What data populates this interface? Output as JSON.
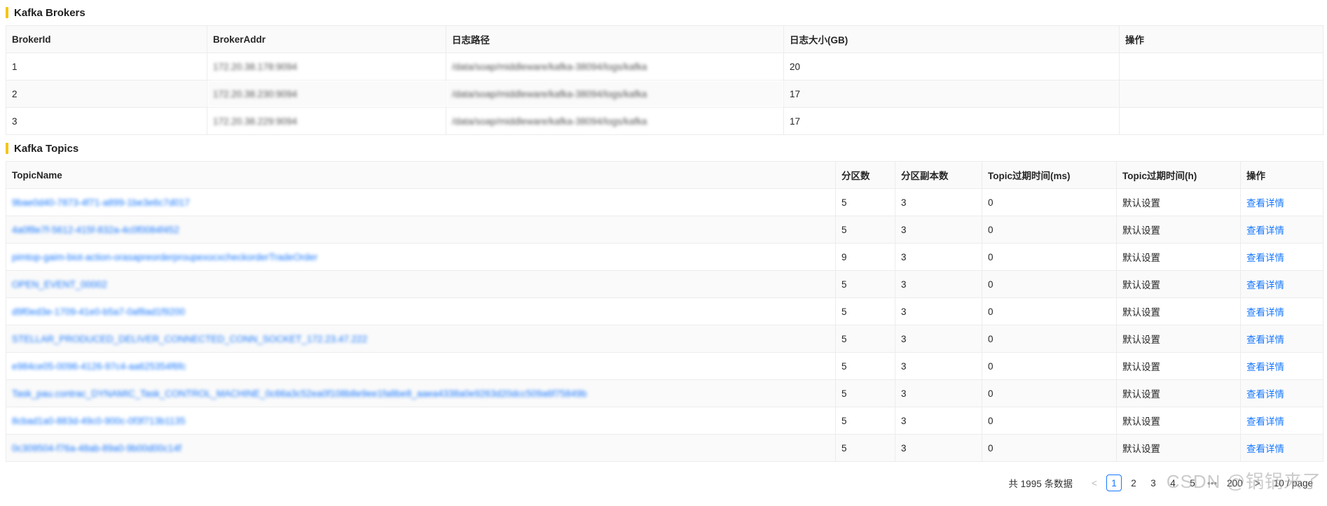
{
  "brokers": {
    "title": "Kafka Brokers",
    "columns": [
      "BrokerId",
      "BrokerAddr",
      "日志路径",
      "日志大小(GB)",
      "操作"
    ],
    "rows": [
      {
        "id": "1",
        "addr": "172.20.38.178:9094",
        "path": "/data/soap/middleware/kafka-38094/logs/kafka",
        "size": "20",
        "action": ""
      },
      {
        "id": "2",
        "addr": "172.20.38.230:9094",
        "path": "/data/soap/middleware/kafka-38094/logs/kafka",
        "size": "17",
        "action": ""
      },
      {
        "id": "3",
        "addr": "172.20.38.229:9094",
        "path": "/data/soap/middleware/kafka-38094/logs/kafka",
        "size": "17",
        "action": ""
      }
    ]
  },
  "topics": {
    "title": "Kafka Topics",
    "columns": [
      "TopicName",
      "分区数",
      "分区副本数",
      "Topic过期时间(ms)",
      "Topic过期时间(h)",
      "操作"
    ],
    "rows": [
      {
        "name": "9bae0d40-7873-4f71-a899-1be3e6c7d017",
        "partitions": "5",
        "replicas": "3",
        "ms": "0",
        "h": "默认设置",
        "action": "查看详情"
      },
      {
        "name": "4a0f8e7f-5612-415f-832a-4c0f0084f452",
        "partitions": "5",
        "replicas": "3",
        "ms": "0",
        "h": "默认设置",
        "action": "查看详情"
      },
      {
        "name": "pimtop-gaim-biot-action-orasapreorderproupexocxcheckorderTradeOrder",
        "partitions": "9",
        "replicas": "3",
        "ms": "0",
        "h": "默认设置",
        "action": "查看详情"
      },
      {
        "name": "OPEN_EVENT_00002",
        "partitions": "5",
        "replicas": "3",
        "ms": "0",
        "h": "默认设置",
        "action": "查看详情"
      },
      {
        "name": "d9f0ed3e-1709-41e0-b5a7-0af8ad1f9200",
        "partitions": "5",
        "replicas": "3",
        "ms": "0",
        "h": "默认设置",
        "action": "查看详情"
      },
      {
        "name": "STELLAR_PRODUCED_DELIVER_CONNECTED_CONN_SOCKET_172.23.47.222",
        "partitions": "5",
        "replicas": "3",
        "ms": "0",
        "h": "默认设置",
        "action": "查看详情"
      },
      {
        "name": "e984ce05-0096-4126-97c4-aa625354f6fc",
        "partitions": "5",
        "replicas": "3",
        "ms": "0",
        "h": "默认设置",
        "action": "查看详情"
      },
      {
        "name": "Task_pau.contrac_DYNAMIC_Task_CONTROL_MACHINE_0c66a3c52ea0f108b8e9ee1fa8be8_aaea4338a0e9263d20dcc509a6f75849b",
        "partitions": "5",
        "replicas": "3",
        "ms": "0",
        "h": "默认设置",
        "action": "查看详情"
      },
      {
        "name": "8cbad1a0-883d-49c0-900c-0f3f713b1135",
        "partitions": "5",
        "replicas": "3",
        "ms": "0",
        "h": "默认设置",
        "action": "查看详情"
      },
      {
        "name": "0c309504-f76a-48ab-89a0-9b00d00c14f",
        "partitions": "5",
        "replicas": "3",
        "ms": "0",
        "h": "默认设置",
        "action": "查看详情"
      }
    ]
  },
  "pagination": {
    "total_text": "共 1995 条数据",
    "prev": "<",
    "pages": [
      "1",
      "2",
      "3",
      "4",
      "5"
    ],
    "ellipsis": "•••",
    "last": "200",
    "next": ">",
    "page_size": "10 / page"
  },
  "watermark": "CSDN @锅锅来了",
  "colors": {
    "accent": "#1677ff",
    "title_bar": "#f5c518"
  }
}
